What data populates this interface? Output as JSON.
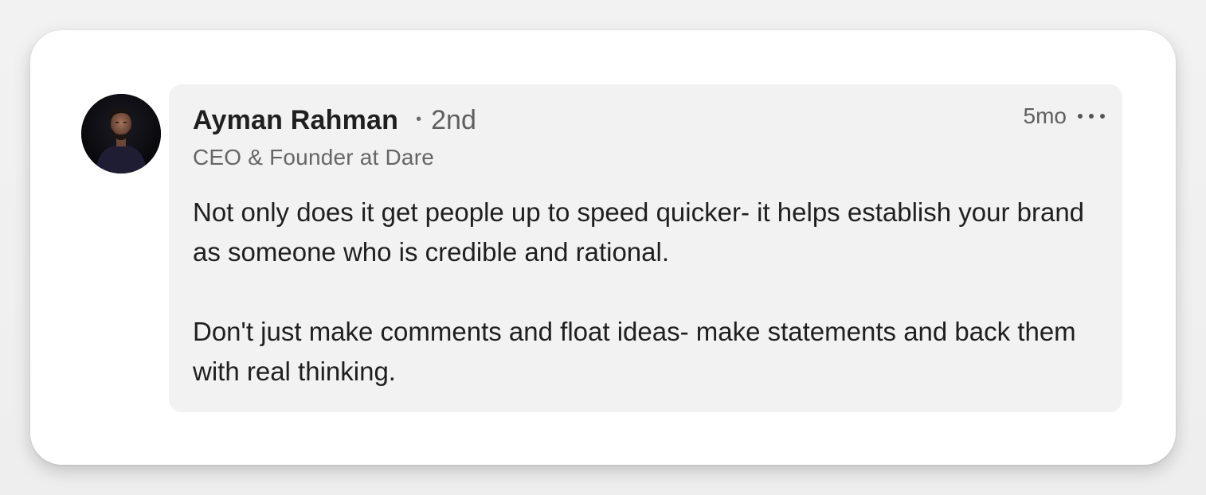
{
  "comment": {
    "author": {
      "name": "Ayman Rahman",
      "connection_dot": "•",
      "connection_degree": "2nd",
      "headline": "CEO & Founder at Dare"
    },
    "timestamp": "5mo",
    "more_menu_icon": "more-horizontal-icon",
    "paragraphs": [
      "Not only does it get people up to speed quicker- it helps establish your brand as someone who is credible and rational.",
      "Don't just make comments and float ideas- make statements and back them with real thinking."
    ]
  },
  "colors": {
    "bubble_background": "#f2f2f2",
    "card_background": "#ffffff",
    "text_primary": "#1f1f1f",
    "text_secondary": "#666666"
  }
}
